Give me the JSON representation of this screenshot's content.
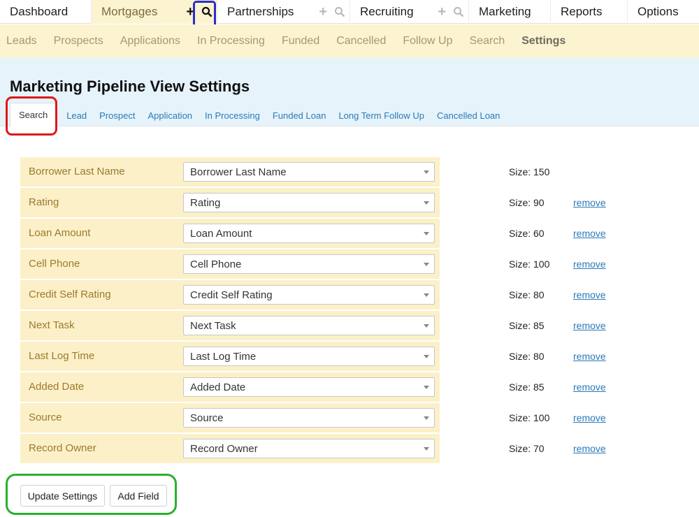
{
  "top_nav": {
    "tabs": [
      {
        "label": "Dashboard"
      },
      {
        "label": "Mortgages"
      },
      {
        "label": "Partnerships"
      },
      {
        "label": "Recruiting"
      },
      {
        "label": "Marketing"
      },
      {
        "label": "Reports"
      },
      {
        "label": "Options"
      }
    ],
    "icons": [
      "plus-icon",
      "search-icon"
    ]
  },
  "sub_nav": {
    "items": [
      {
        "label": "Leads"
      },
      {
        "label": "Prospects"
      },
      {
        "label": "Applications"
      },
      {
        "label": "In Processing"
      },
      {
        "label": "Funded"
      },
      {
        "label": "Cancelled"
      },
      {
        "label": "Follow Up"
      },
      {
        "label": "Search"
      },
      {
        "label": "Settings"
      }
    ],
    "active": "Settings"
  },
  "page": {
    "title": "Marketing Pipeline View Settings",
    "tabs": [
      {
        "label": "Search"
      },
      {
        "label": "Lead"
      },
      {
        "label": "Prospect"
      },
      {
        "label": "Application"
      },
      {
        "label": "In Processing"
      },
      {
        "label": "Funded Loan"
      },
      {
        "label": "Long Term Follow Up"
      },
      {
        "label": "Cancelled Loan"
      }
    ],
    "active_tab": "Search"
  },
  "fields": [
    {
      "label": "Borrower Last Name",
      "value": "Borrower Last Name",
      "size": "Size: 150",
      "remove": ""
    },
    {
      "label": "Rating",
      "value": "Rating",
      "size": "Size: 90",
      "remove": "remove"
    },
    {
      "label": "Loan Amount",
      "value": "Loan Amount",
      "size": "Size: 60",
      "remove": "remove"
    },
    {
      "label": "Cell Phone",
      "value": "Cell Phone",
      "size": "Size: 100",
      "remove": "remove"
    },
    {
      "label": "Credit Self Rating",
      "value": "Credit Self Rating",
      "size": "Size: 80",
      "remove": "remove"
    },
    {
      "label": "Next Task",
      "value": "Next Task",
      "size": "Size: 85",
      "remove": "remove"
    },
    {
      "label": "Last Log Time",
      "value": "Last Log Time",
      "size": "Size: 80",
      "remove": "remove"
    },
    {
      "label": "Added Date",
      "value": "Added Date",
      "size": "Size: 85",
      "remove": "remove"
    },
    {
      "label": "Source",
      "value": "Source",
      "size": "Size: 100",
      "remove": "remove"
    },
    {
      "label": "Record Owner",
      "value": "Record Owner",
      "size": "Size: 70",
      "remove": "remove"
    }
  ],
  "buttons": {
    "update_label": "Update Settings",
    "add_label": "Add Field"
  },
  "colors": {
    "accent_bg": "#fcf3d1",
    "link": "#2a7ab8",
    "highlight_red": "#e01818",
    "highlight_blue": "#2b2fc8",
    "highlight_green": "#2bb02f"
  }
}
